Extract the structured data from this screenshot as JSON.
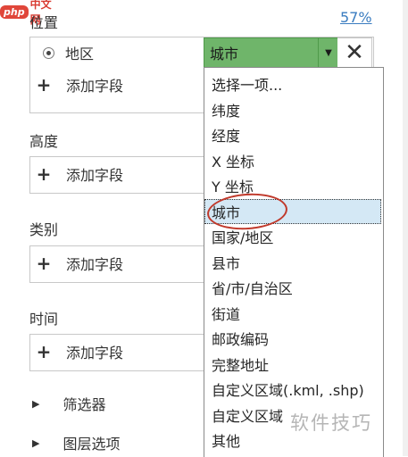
{
  "watermark": {
    "badge": "php",
    "text": "中文网",
    "bottom": "软件技巧"
  },
  "location": {
    "label": "位置",
    "percent": "57%",
    "radio_label": "地区",
    "combo_value": "城市",
    "combo_arrow": "▼",
    "close": "✕",
    "add_field": "添加字段"
  },
  "height": {
    "label": "高度",
    "add_field": "添加字段"
  },
  "category": {
    "label": "类别",
    "add_field": "添加字段"
  },
  "time": {
    "label": "时间",
    "add_field": "添加字段"
  },
  "expanders": {
    "arrow": "▶",
    "filters": "筛选器",
    "layer_options": "图层选项"
  },
  "dropdown": {
    "items": [
      "选择一项...",
      "纬度",
      "经度",
      "X 坐标",
      "Y 坐标",
      "城市",
      "国家/地区",
      "县市",
      "省/市/自治区",
      "街道",
      "邮政编码",
      "完整地址",
      "自定义区域(.kml, .shp)",
      "自定义区域",
      "其他"
    ],
    "selected_index": 5
  },
  "colors": {
    "combo_green": "#6fb56a",
    "link_blue": "#3a7cc0",
    "selection_blue": "#d4e8f5",
    "annotation_red": "#c0392b"
  }
}
